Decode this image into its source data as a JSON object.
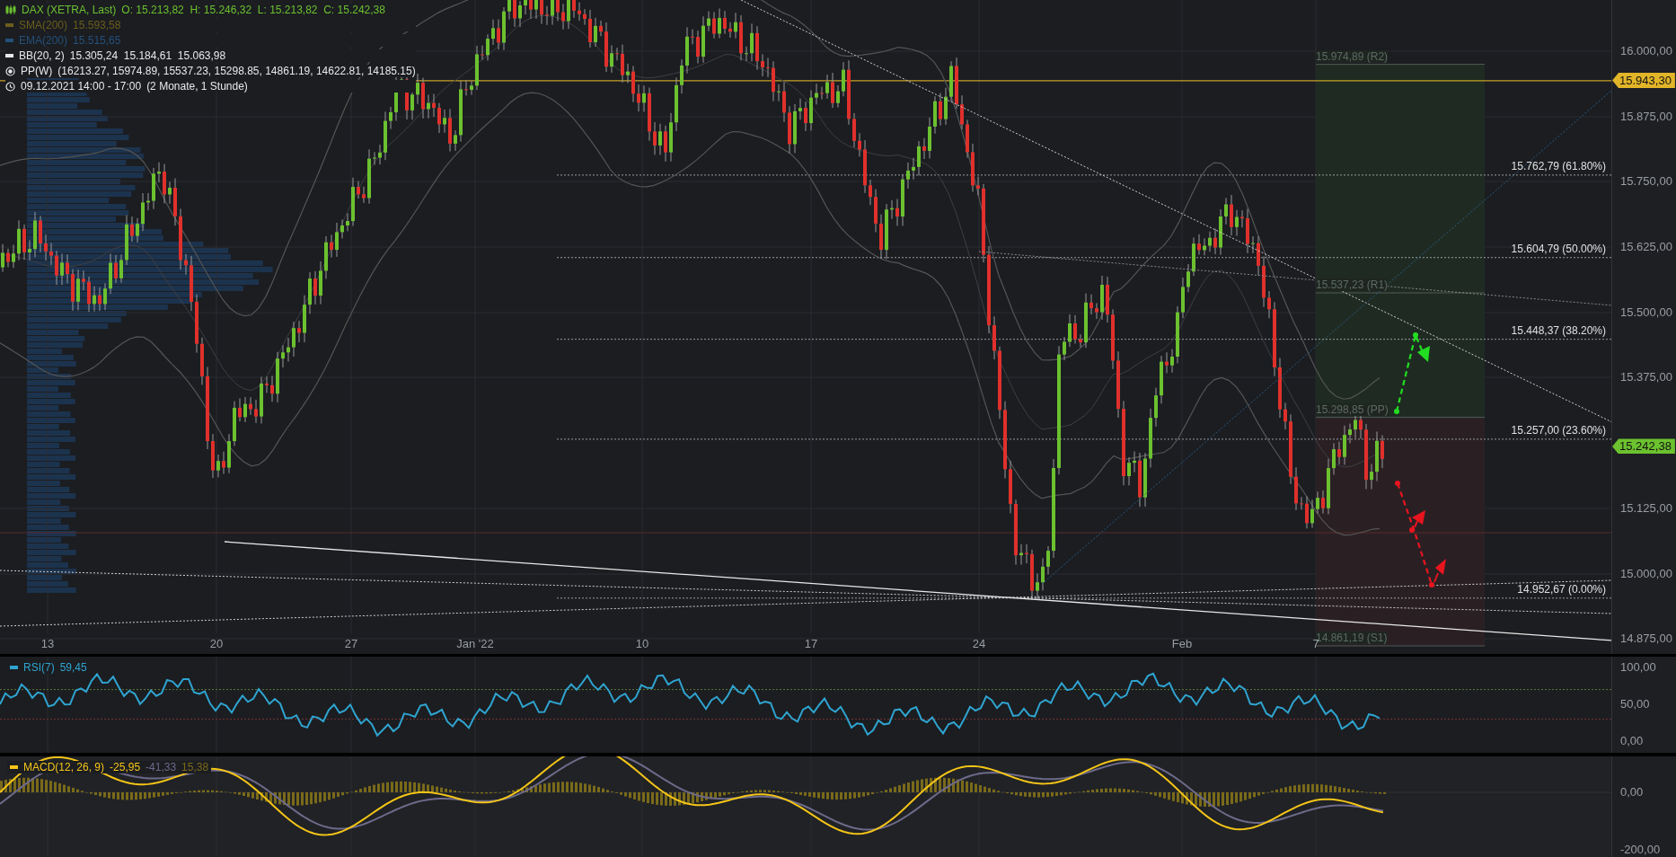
{
  "legend": [
    {
      "kind": "ohlc",
      "label": "DAX (XETRA, Last)",
      "value": "O: 15.213,82  H: 15.246,32  L: 15.213,82  C: 15.242,38",
      "color": "#6cc12f"
    },
    {
      "kind": "line",
      "label": "SMA(200)",
      "value": "15.593,58",
      "color": "#6b5d1a"
    },
    {
      "kind": "line",
      "label": "EMA(200)",
      "value": "15.515,65",
      "color": "#24507a"
    },
    {
      "kind": "line",
      "label": "BB(20, 2)",
      "value": "15.305,24  15.184,61  15.063,98",
      "color": "#e8e8e8"
    },
    {
      "kind": "pivot",
      "label": "PP(W)",
      "value": "(16213.27, 15974.89, 15537.23, 15298.85, 14861.19, 14622.81, 14185.15)",
      "color": "#e8e8e8"
    },
    {
      "kind": "time",
      "label": "09.12.2021 14:00 - 17:00",
      "value": "(2 Monate, 1 Stunde)",
      "color": "#e8e8e8"
    }
  ],
  "price_axis": [
    "16.000,00",
    "15.875,00",
    "15.750,00",
    "15.625,00",
    "15.500,00",
    "15.375,00",
    "15.125,00",
    "15.000,00",
    "14.875,00"
  ],
  "price_tags": [
    {
      "text": "15.943,30",
      "color": "#e2b529"
    },
    {
      "text": "15.242,38",
      "color": "#6cc12f"
    }
  ],
  "fib_levels": [
    "15.762,79 (61.80%)",
    "15.604,79 (50.00%)",
    "15.448,37 (38.20%)",
    "15.257,00 (23.60%)",
    "14.952,67 (0.00%)"
  ],
  "pivot_labels": [
    "15.974,89 (R2)",
    "15.537,23 (R1)",
    "15.298,85 (PP)",
    "14.861,19 (S1)"
  ],
  "time_axis": [
    "13",
    "20",
    "27",
    "Jan '22",
    "10",
    "17",
    "24",
    "Feb",
    "7"
  ],
  "rsi": {
    "label": "RSI(7)",
    "value": "59,45",
    "axis": [
      "100,00",
      "50,00",
      "0,00"
    ]
  },
  "macd": {
    "label": "MACD(12, 26, 9)",
    "values": [
      {
        "text": "-25,95",
        "color": "#f5c518"
      },
      {
        "text": "-41,33",
        "color": "#6d6a8a"
      },
      {
        "text": "15,38",
        "color": "#7a6a1a"
      }
    ],
    "axis": [
      "0,00",
      "-200,00"
    ]
  }
}
